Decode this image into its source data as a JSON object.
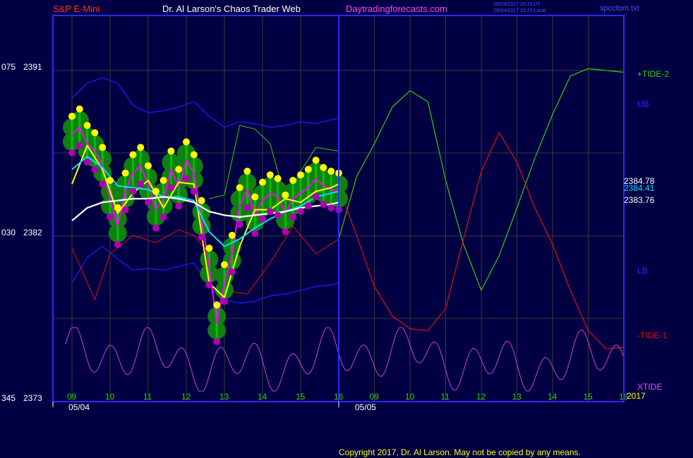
{
  "header": {
    "market": "S&P E-Mini",
    "author": "Dr. Al Larson's Chaos Trader Web",
    "site": "Daytradingforecasts.com",
    "time_ut": "05/04/2017 20:20 UT",
    "time_local": "05/04/2017 15:20 Local",
    "file": "spcctom.txt"
  },
  "footer": {
    "copyright": "Copyright 2017, Dr. Al Larson. May not be copied by any means."
  },
  "colors": {
    "background": "#000043",
    "frame": "#2a2aff",
    "grid": "#3a3a3a",
    "price_bar": "#00c000",
    "high_dot": "#ffff00",
    "low_dot": "#b000b0",
    "halo": "#108010",
    "fast_avg": "#ffff00",
    "magenta_avg": "#ff00ff",
    "cyan_avg": "#00e0ff",
    "white_avg": "#ffffff",
    "bands": "#1a1aff",
    "tide_plus": "#30d000",
    "tide_minus": "#e01010",
    "xtide": "#d040d0"
  },
  "chart_data": {
    "type": "line",
    "title": "S&P E-Mini",
    "y_axis_left": [
      {
        "code": "075",
        "price": "2391"
      },
      {
        "code": "030",
        "price": "2382"
      },
      {
        "code": "345",
        "price": "2373"
      }
    ],
    "ylim": [
      2373,
      2391
    ],
    "x_hour_ticks_day1": [
      "09",
      "10",
      "11",
      "12",
      "13",
      "14",
      "15",
      "16"
    ],
    "x_hour_ticks_day2": [
      "09",
      "10",
      "11",
      "12",
      "13",
      "14",
      "15",
      "16"
    ],
    "dates": [
      "05/04",
      "05/05"
    ],
    "year_label": "2017",
    "right_labels": {
      "tide_plus": "+TIDE-2",
      "upper_band": "UB",
      "lower_band": "LB",
      "tide_minus": "-TIDE-1",
      "xtide": "XTIDE"
    },
    "last_values": [
      "2384.78",
      "2384.41",
      "2383.76"
    ],
    "series": [
      {
        "key": "price",
        "x": [
          9.0,
          9.2,
          9.4,
          9.6,
          9.8,
          10.0,
          10.2,
          10.4,
          10.6,
          10.8,
          11.0,
          11.2,
          11.4,
          11.6,
          11.8,
          12.0,
          12.2,
          12.4,
          12.6,
          12.8,
          13.0,
          13.2,
          13.4,
          13.6,
          13.8,
          14.0,
          14.2,
          14.4,
          14.6,
          14.8,
          15.0,
          15.2,
          15.4,
          15.6,
          15.8,
          16.0
        ],
        "values": [
          2387.5,
          2387.9,
          2387.0,
          2386.6,
          2385.8,
          2384.0,
          2382.5,
          2384.4,
          2385.4,
          2385.8,
          2384.8,
          2383.4,
          2384.0,
          2385.6,
          2384.6,
          2386.1,
          2385.4,
          2382.9,
          2380.3,
          2377.2,
          2379.4,
          2381.0,
          2383.6,
          2384.5,
          2383.1,
          2383.9,
          2384.3,
          2384.1,
          2383.2,
          2384.0,
          2384.3,
          2384.6,
          2385.1,
          2384.7,
          2384.5,
          2384.4
        ]
      },
      {
        "key": "fast_avg",
        "x": [
          9.0,
          9.4,
          9.8,
          10.2,
          10.6,
          11.0,
          11.4,
          11.8,
          12.2,
          12.6,
          13.0,
          13.4,
          13.8,
          14.2,
          14.6,
          15.0,
          15.4,
          15.8,
          16.0
        ],
        "values": [
          2384.8,
          2386.9,
          2385.6,
          2383.2,
          2384.3,
          2385.0,
          2383.5,
          2384.9,
          2384.8,
          2379.4,
          2378.6,
          2381.4,
          2383.4,
          2383.4,
          2384.0,
          2383.8,
          2384.4,
          2384.6,
          2384.8
        ]
      },
      {
        "key": "cyan_avg",
        "x": [
          9.0,
          9.4,
          9.8,
          10.2,
          10.6,
          11.0,
          11.4,
          11.8,
          12.2,
          12.6,
          13.0,
          13.4,
          13.8,
          14.2,
          14.6,
          15.0,
          15.4,
          15.8,
          16.0
        ],
        "values": [
          2385.6,
          2386.3,
          2385.7,
          2384.7,
          2384.6,
          2384.5,
          2384.1,
          2384.1,
          2383.9,
          2382.2,
          2381.4,
          2381.8,
          2382.4,
          2382.9,
          2383.3,
          2383.6,
          2384.1,
          2384.3,
          2384.4
        ]
      },
      {
        "key": "white_avg",
        "x": [
          9.0,
          9.4,
          9.8,
          10.2,
          10.6,
          11.0,
          11.4,
          11.8,
          12.2,
          12.6,
          13.0,
          13.4,
          13.8,
          14.2,
          14.6,
          15.0,
          15.4,
          15.8,
          16.0
        ],
        "values": [
          2382.8,
          2383.5,
          2383.8,
          2383.9,
          2384.0,
          2384.0,
          2384.1,
          2384.0,
          2383.8,
          2383.3,
          2383.1,
          2383.0,
          2383.1,
          2383.2,
          2383.3,
          2383.5,
          2383.6,
          2383.7,
          2383.8
        ]
      },
      {
        "key": "upper_band",
        "x": [
          9.0,
          9.4,
          9.8,
          10.2,
          10.6,
          11.0,
          11.4,
          11.8,
          12.2,
          12.6,
          13.0,
          13.4,
          13.8,
          14.2,
          14.6,
          15.0,
          15.4,
          15.8,
          16.0
        ],
        "values": [
          2389.5,
          2390.3,
          2390.6,
          2390.3,
          2389.1,
          2388.7,
          2388.8,
          2389.0,
          2389.3,
          2388.5,
          2387.9,
          2388.2,
          2388.1,
          2387.9,
          2388.0,
          2388.2,
          2388.1,
          2388.3,
          2388.4
        ]
      },
      {
        "key": "lower_band",
        "x": [
          9.0,
          9.4,
          9.8,
          10.2,
          10.6,
          11.0,
          11.4,
          11.8,
          12.2,
          12.6,
          13.0,
          13.4,
          13.8,
          14.2,
          14.6,
          15.0,
          15.4,
          15.8,
          16.0
        ],
        "values": [
          2379.4,
          2380.8,
          2381.4,
          2380.7,
          2380.1,
          2380.2,
          2380.1,
          2380.3,
          2380.5,
          2379.2,
          2378.5,
          2378.3,
          2378.4,
          2378.7,
          2378.8,
          2379.0,
          2379.2,
          2379.3,
          2379.4
        ]
      },
      {
        "key": "tide_plus",
        "x": [
          16.0,
          16.5,
          17.0,
          17.5,
          18.0,
          18.5,
          19.0,
          19.5,
          20.0,
          20.5,
          21.0,
          21.5,
          22.0,
          22.5,
          23.0,
          23.5,
          24.0
        ],
        "values": [
          2381.8,
          2385.2,
          2387.0,
          2389.0,
          2389.9,
          2389.3,
          2385.0,
          2381.5,
          2379.0,
          2380.9,
          2383.5,
          2386.2,
          2388.6,
          2390.7,
          2391.1,
          2391.0,
          2390.9
        ]
      },
      {
        "key": "tide_minus",
        "x": [
          16.0,
          16.5,
          17.0,
          17.5,
          18.0,
          18.5,
          19.0,
          19.5,
          20.0,
          20.5,
          21.0,
          21.5,
          22.0,
          22.5,
          23.0,
          23.5,
          24.0
        ],
        "values": [
          2384.6,
          2382.0,
          2379.2,
          2377.6,
          2376.9,
          2376.8,
          2378.0,
          2381.8,
          2385.5,
          2387.6,
          2386.0,
          2383.5,
          2381.5,
          2379.0,
          2376.8,
          2375.8,
          2375.9
        ]
      }
    ]
  }
}
